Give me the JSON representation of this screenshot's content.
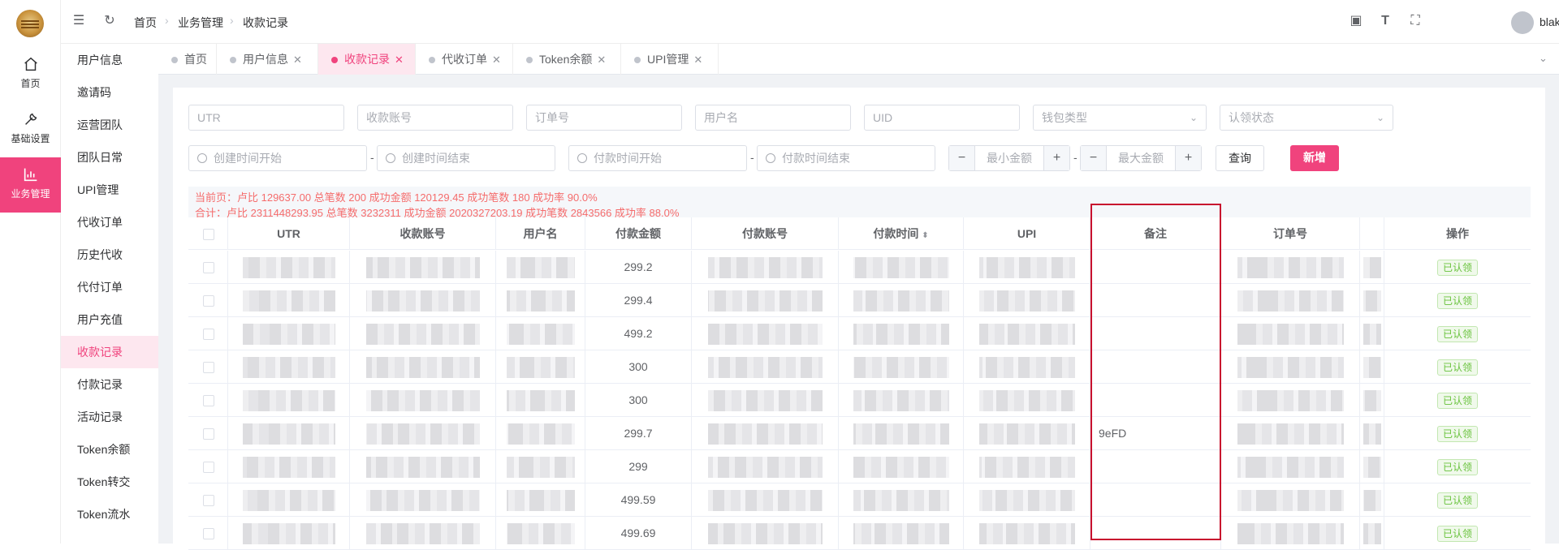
{
  "nav_rail": {
    "items": [
      {
        "label": "首页",
        "icon": "home-icon"
      },
      {
        "label": "基础设置",
        "icon": "wrench-icon"
      },
      {
        "label": "业务管理",
        "icon": "bar-chart-icon"
      }
    ]
  },
  "sidebar": {
    "items": [
      {
        "label": "用户信息"
      },
      {
        "label": "邀请码"
      },
      {
        "label": "运营团队"
      },
      {
        "label": "团队日常"
      },
      {
        "label": "UPI管理"
      },
      {
        "label": "代收订单"
      },
      {
        "label": "历史代收"
      },
      {
        "label": "代付订单"
      },
      {
        "label": "用户充值"
      },
      {
        "label": "收款记录"
      },
      {
        "label": "付款记录"
      },
      {
        "label": "活动记录"
      },
      {
        "label": "Token余额"
      },
      {
        "label": "Token转交"
      },
      {
        "label": "Token流水"
      }
    ],
    "active_index": 9
  },
  "header": {
    "breadcrumb": [
      "首页",
      "业务管理",
      "收款记录"
    ],
    "username": "blake"
  },
  "tabs": [
    {
      "label": "首页",
      "closable": false
    },
    {
      "label": "用户信息",
      "closable": true
    },
    {
      "label": "收款记录",
      "closable": true,
      "active": true
    },
    {
      "label": "代收订单",
      "closable": true
    },
    {
      "label": "Token余额",
      "closable": true
    },
    {
      "label": "UPI管理",
      "closable": true
    }
  ],
  "filters": {
    "utr": "UTR",
    "account": "收款账号",
    "order_no": "订单号",
    "username": "用户名",
    "uid": "UID",
    "wallet_type": "钱包类型",
    "claim_status": "认领状态",
    "create_start": "创建时间开始",
    "create_end": "创建时间结束",
    "pay_start": "付款时间开始",
    "pay_end": "付款时间结束",
    "min_amount": "最小金额",
    "max_amount": "最大金额",
    "dash": "-",
    "query_label": "查询",
    "add_label": "新增"
  },
  "stats": {
    "current_page": "当前页：卢比 129637.00 总笔数 200 成功金额 120129.45 成功笔数 180 成功率 90.0%",
    "total": "合计：卢比 2311448293.95 总笔数 3232311 成功金额 2020327203.19 成功笔数 2843566 成功率 88.0%"
  },
  "table": {
    "columns": [
      "UTR",
      "收款账号",
      "用户名",
      "付款金额",
      "付款账号",
      "付款时间",
      "UPI",
      "备注",
      "订单号",
      "操作"
    ],
    "rows": [
      {
        "amount": "299.2",
        "note": "",
        "action": "已认领"
      },
      {
        "amount": "299.4",
        "note": "",
        "action": "已认领"
      },
      {
        "amount": "499.2",
        "note": "",
        "action": "已认领"
      },
      {
        "amount": "300",
        "note": "",
        "action": "已认领"
      },
      {
        "amount": "300",
        "note": "",
        "action": "已认领"
      },
      {
        "amount": "299.7",
        "note": "9eFD",
        "action": "已认领"
      },
      {
        "amount": "299",
        "note": "",
        "action": "已认领"
      },
      {
        "amount": "499.59",
        "note": "",
        "action": "已认领"
      },
      {
        "amount": "499.69",
        "note": "",
        "action": "已认领"
      }
    ]
  },
  "colors": {
    "accent": "#f0437d",
    "highlight_box": "#c8102e",
    "stat_text": "#f56c6c",
    "badge_green": "#67c23a"
  }
}
